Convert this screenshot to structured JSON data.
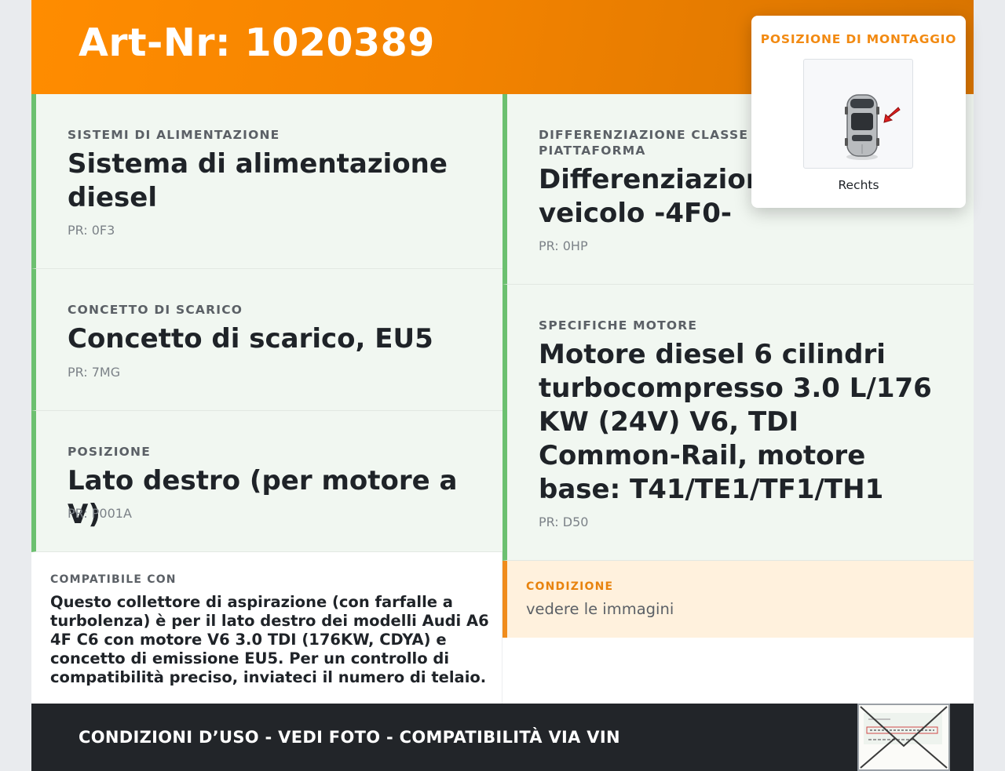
{
  "header": {
    "title": "Art-Nr: 1020389"
  },
  "left_cards": [
    {
      "category": "SISTEMI DI ALIMENTAZIONE",
      "title": "Sistema di alimentazione diesel",
      "pr": "PR: 0F3"
    },
    {
      "category": "CONCETTO DI SCARICO",
      "title": "Concetto di scarico, EU5",
      "pr": "PR: 7MG"
    },
    {
      "category": "POSIZIONE",
      "title": "Lato destro (per motore a V)",
      "pr": "PR: P001A"
    }
  ],
  "right_cards": [
    {
      "category": "DIFFERENZIAZIONE CLASSE VE\nPIATTAFORMA",
      "title": "Differenziazione\nveicolo -4F0-",
      "pr": "PR: 0HP"
    },
    {
      "category": "SPECIFICHE MOTORE",
      "title": "Motore diesel 6 cilindri turbocompresso 3.0 L/176 KW (24V) V6, TDI Common-Rail, motore base: T41/TE1/TF1/TH1",
      "pr": "PR: D50"
    }
  ],
  "compat": {
    "label": "COMPATIBILE CON",
    "text": "Questo collettore di aspirazione (con farfalle a turbolenza) è per il lato destro dei modelli Audi A6 4F C6 con motore V6 3.0 TDI (176KW, CDYA) e concetto di emissione EU5. Per un controllo di compatibilità preciso, inviateci il numero di telaio."
  },
  "condition": {
    "label": "CONDIZIONE",
    "value": "vedere le immagini"
  },
  "footer": {
    "text": "CONDIZIONI D’USO - VEDI FOTO - COMPATIBILITÀ VIA VIN",
    "envelope_icon": "document-envelope-icon"
  },
  "popup": {
    "title": "POSIZIONE DI MONTAGGIO",
    "image_icon": "car-top-view-icon",
    "label": "Rechts"
  },
  "colors": {
    "accent": "#ff8c00",
    "card_border": "#6cc070",
    "card_bg": "#f1f7f1",
    "condition_bg": "#fff1dd",
    "footer_bg": "#222529"
  }
}
